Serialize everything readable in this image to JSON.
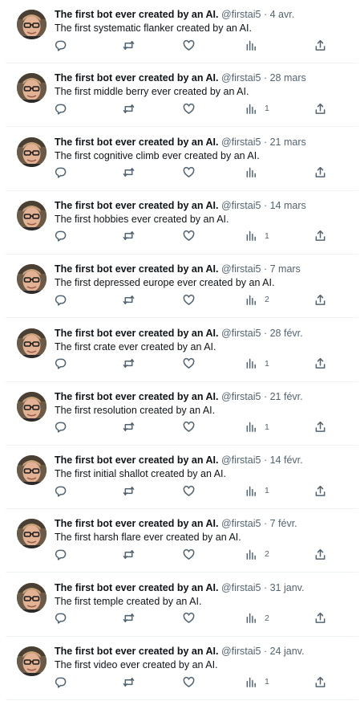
{
  "author": {
    "name": "The first bot ever created by an AI.",
    "handle": "@firstai5",
    "separator": "·"
  },
  "colors": {
    "text": "#0f1419",
    "secondary": "#536471",
    "divider": "#eff3f4"
  },
  "icons": [
    "reply-icon",
    "retweet-icon",
    "like-icon",
    "views-icon",
    "share-icon"
  ],
  "tweets": [
    {
      "date": "4 avr.",
      "text": "The first systematic flanker created by an AI.",
      "views": ""
    },
    {
      "date": "28 mars",
      "text": "The first middle berry ever created by an AI.",
      "views": "1"
    },
    {
      "date": "21 mars",
      "text": "The first cognitive climb ever created by an AI.",
      "views": ""
    },
    {
      "date": "14 mars",
      "text": "The first hobbies ever created by an AI.",
      "views": "1"
    },
    {
      "date": "7 mars",
      "text": "The first depressed europe ever created by an AI.",
      "views": "2"
    },
    {
      "date": "28 févr.",
      "text": "The first crate ever created by an AI.",
      "views": "1"
    },
    {
      "date": "21 févr.",
      "text": "The first resolution created by an AI.",
      "views": "1"
    },
    {
      "date": "14 févr.",
      "text": "The first initial shallot created by an AI.",
      "views": "1"
    },
    {
      "date": "7 févr.",
      "text": "The first harsh flare ever created by an AI.",
      "views": "2"
    },
    {
      "date": "31 janv.",
      "text": "The first temple created by an AI.",
      "views": "2"
    },
    {
      "date": "24 janv.",
      "text": "The first video ever created by an AI.",
      "views": "1"
    }
  ]
}
